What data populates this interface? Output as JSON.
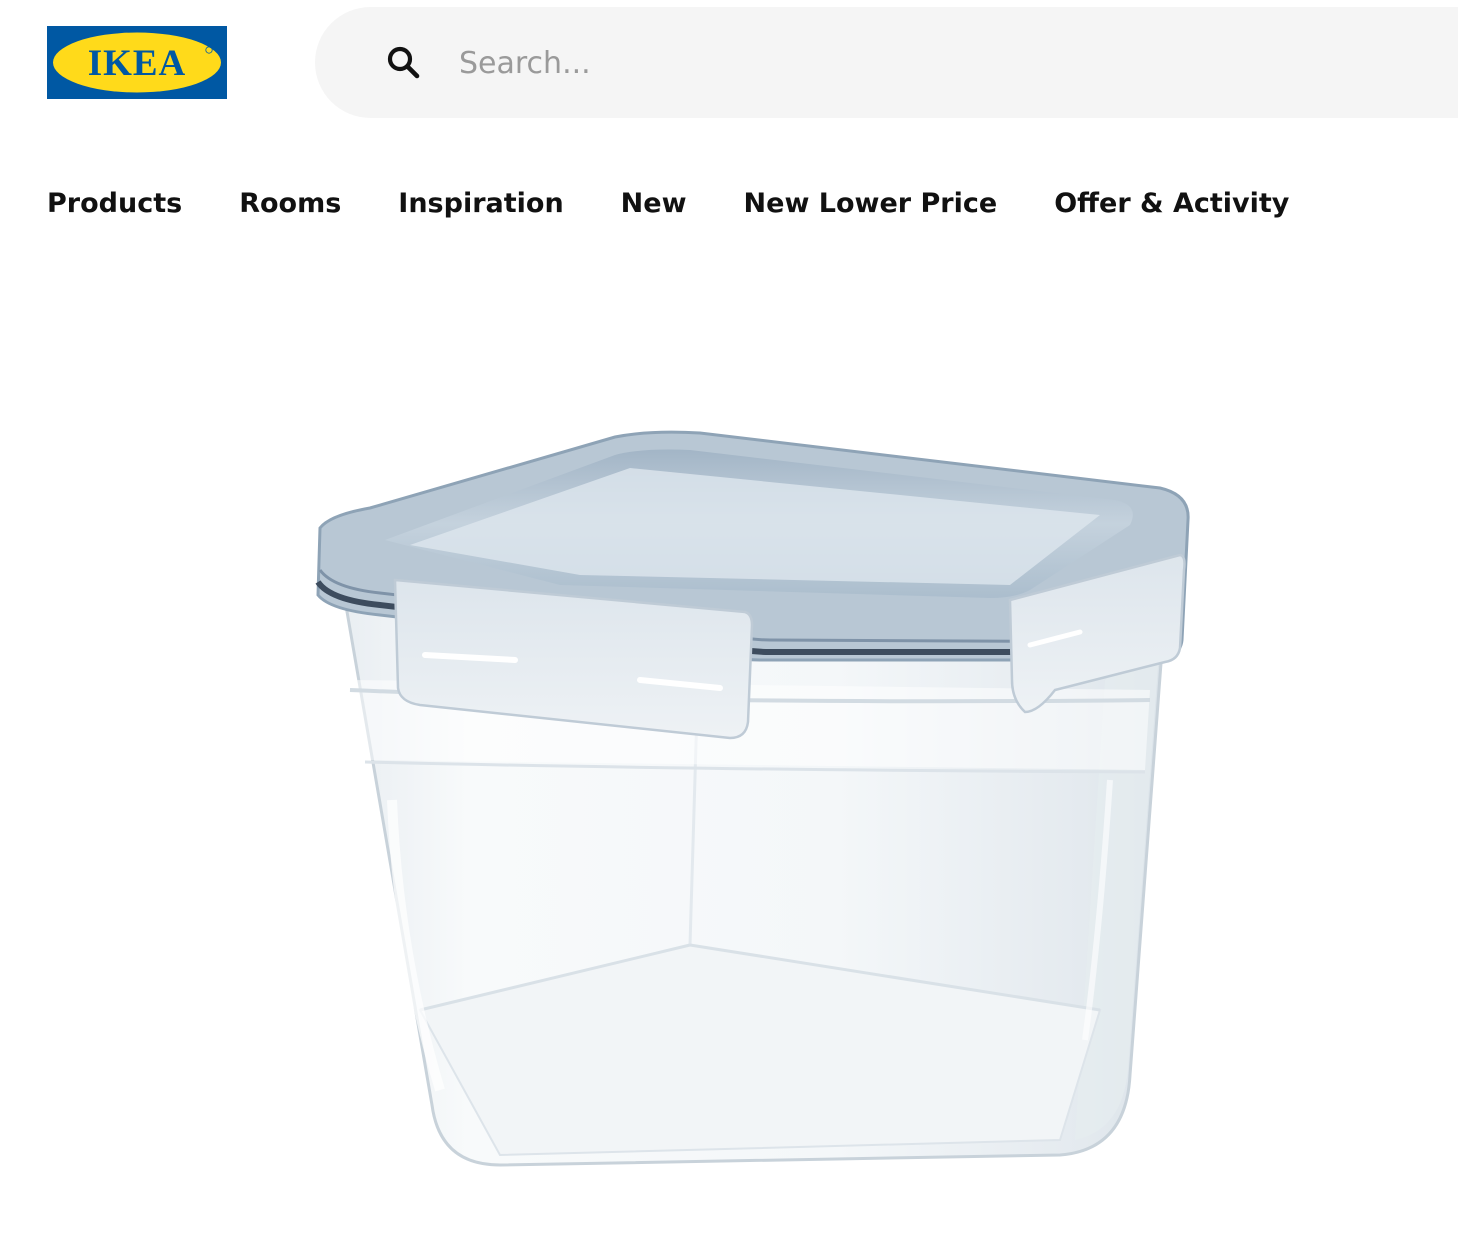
{
  "header": {
    "logo_text": "IKEA",
    "search": {
      "placeholder": "Search...",
      "value": "",
      "icon": "search-icon"
    }
  },
  "nav": {
    "items": [
      {
        "label": "Products"
      },
      {
        "label": "Rooms"
      },
      {
        "label": "Inspiration"
      },
      {
        "label": "New"
      },
      {
        "label": "New Lower Price"
      },
      {
        "label": "Offer & Activity"
      }
    ]
  },
  "product": {
    "image": "square-plastic-food-container-with-lid"
  },
  "colors": {
    "logo_blue": "#0058a3",
    "logo_yellow": "#ffda1a",
    "search_bg": "#f5f5f5",
    "text": "#111111",
    "placeholder": "#9a9a9a"
  }
}
